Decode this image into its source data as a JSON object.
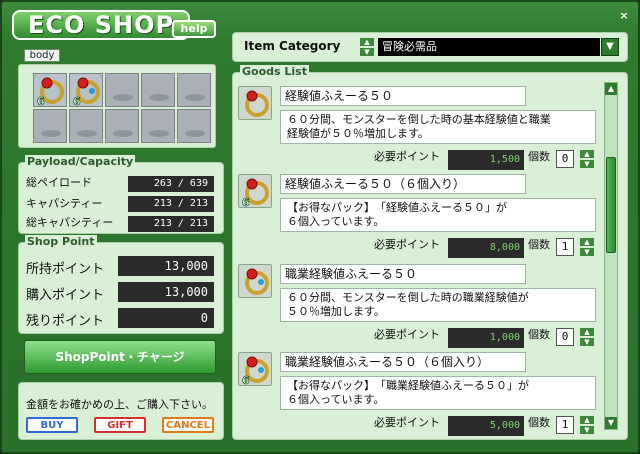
{
  "app": {
    "title": "ECO SHOP",
    "help_label": "help",
    "close_label": "×"
  },
  "body_tab": "body",
  "inventory": {
    "filled_slots": 2,
    "total_slots": 10,
    "badge": "6"
  },
  "payload": {
    "legend": "Payload/Capacity",
    "rows": [
      {
        "label": "総ペイロード",
        "value": "263 / 639"
      },
      {
        "label": "キャパシティー",
        "value": "213 / 213"
      },
      {
        "label": "総キャパシティー",
        "value": "213 / 213"
      }
    ]
  },
  "shop_point": {
    "legend": "Shop Point",
    "rows": [
      {
        "label": "所持ポイント",
        "value": "13,000"
      },
      {
        "label": "購入ポイント",
        "value": "13,000"
      },
      {
        "label": "残りポイント",
        "value": "0"
      }
    ]
  },
  "charge_button": "ShopPoint・チャージ",
  "confirm_text": "金額をお確かめの上、ご購入下さい。",
  "actions": {
    "buy": "BUY",
    "gift": "GIFT",
    "cancel": "CANCEL"
  },
  "colors": {
    "buy": "#2f6bd6",
    "gift": "#d62f2f",
    "cancel": "#e07a1a",
    "accent": "#2f7a2f"
  },
  "category": {
    "label": "Item Category",
    "selected": "冒険必需品"
  },
  "goods": {
    "legend": "Goods List",
    "point_label": "必要ポイント",
    "qty_label": "個数",
    "items": [
      {
        "name": "経験値ふえーる５０",
        "desc_line1": "６０分間、モンスターを倒した時の基本経験値と職業",
        "desc_line2": "経験値が５０％増加します。",
        "points": "1,500",
        "qty": "0",
        "icon": "experience-ring-icon",
        "badge": ""
      },
      {
        "name": "経験値ふえーる５０（６個入り）",
        "desc_line1": "【お得なパック】　「経験値ふえーる５０」が",
        "desc_line2": "６個入っています。",
        "points": "8,000",
        "qty": "1",
        "icon": "experience-ring-pack-icon",
        "badge": "6"
      },
      {
        "name": "職業経験値ふえーる５０",
        "desc_line1": "６０分間、モンスターを倒した時の職業経験値が",
        "desc_line2": "５０％増加します。",
        "points": "1,000",
        "qty": "0",
        "icon": "job-experience-ring-icon",
        "badge": ""
      },
      {
        "name": "職業経験値ふえーる５０（６個入り）",
        "desc_line1": "【お得なパック】　「職業経験値ふえーる５０」が",
        "desc_line2": "６個入っています。",
        "points": "5,000",
        "qty": "1",
        "icon": "job-experience-ring-pack-icon",
        "badge": "6"
      }
    ]
  }
}
